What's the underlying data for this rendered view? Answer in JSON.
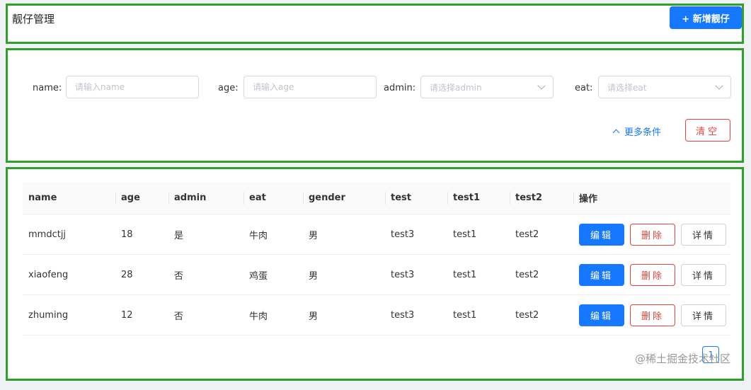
{
  "header": {
    "title": "靓仔管理",
    "add_label": "+ 新增靓仔"
  },
  "filters": {
    "name": {
      "label": "name:",
      "placeholder": "请输入name"
    },
    "age": {
      "label": "age:",
      "placeholder": "请输入age"
    },
    "admin": {
      "label": "admin:",
      "placeholder": "请选择admin"
    },
    "eat": {
      "label": "eat:",
      "placeholder": "请选择eat"
    },
    "more_label": "更多条件",
    "clear_label": "清空"
  },
  "table": {
    "columns": [
      "name",
      "age",
      "admin",
      "eat",
      "gender",
      "test",
      "test1",
      "test2",
      "操作"
    ],
    "rows": [
      [
        "mmdctjj",
        "18",
        "是",
        "牛肉",
        "男",
        "test3",
        "test1",
        "test2"
      ],
      [
        "xiaofeng",
        "28",
        "否",
        "鸡蛋",
        "男",
        "test3",
        "test1",
        "test2"
      ],
      [
        "zhuming",
        "12",
        "否",
        "牛肉",
        "男",
        "test3",
        "test1",
        "test2"
      ]
    ],
    "actions": {
      "edit": "编辑",
      "delete": "删除",
      "detail": "详情"
    }
  },
  "pagination": {
    "current": "1",
    "prev_icon": "chevron-left-icon",
    "next_icon": "chevron-right-icon"
  },
  "watermark": "@稀土掘金技术社区",
  "colors": {
    "primary": "#1677ff",
    "danger": "#e0463c",
    "outline": "#2ea12a"
  }
}
